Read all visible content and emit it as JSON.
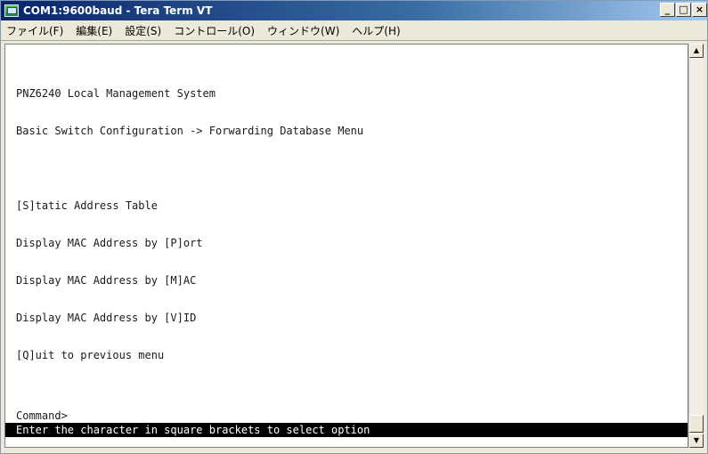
{
  "window": {
    "title": "COM1:9600baud - Tera Term VT",
    "minimize_label": "_",
    "maximize_label": "□",
    "close_label": "×"
  },
  "menubar": {
    "items": [
      {
        "label": "ファイル(F)"
      },
      {
        "label": "編集(E)"
      },
      {
        "label": "設定(S)"
      },
      {
        "label": "コントロール(O)"
      },
      {
        "label": "ウィンドウ(W)"
      },
      {
        "label": "ヘルプ(H)"
      }
    ]
  },
  "terminal": {
    "lines": [
      "PNZ6240 Local Management System",
      "Basic Switch Configuration -> Forwarding Database Menu",
      "",
      "[S]tatic Address Table",
      "Display MAC Address by [P]ort",
      "Display MAC Address by [M]AC",
      "Display MAC Address by [V]ID",
      "[Q]uit to previous menu"
    ],
    "prompt": "Command>",
    "status": "Enter the character in square brackets to select option"
  },
  "scrollbar": {
    "up_icon": "arrow-up-icon",
    "down_icon": "arrow-down-icon"
  }
}
